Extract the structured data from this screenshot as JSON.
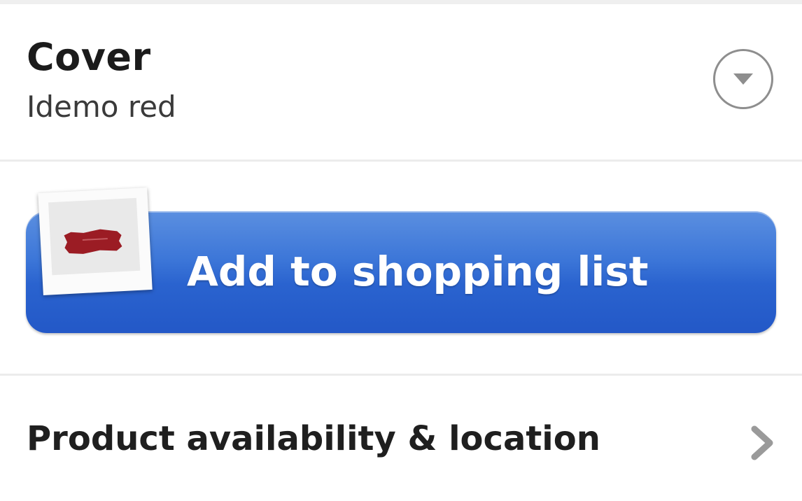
{
  "cover": {
    "title": "Cover",
    "value": "Idemo red",
    "dropdown_icon": "chevron-down-circle-icon"
  },
  "shopping_list": {
    "button_label": "Add to shopping list",
    "thumbnail_icon": "product-thumbnail-icon",
    "accent_color": "#2a63cf"
  },
  "product": {
    "label": "Product availability & location",
    "chevron_icon": "chevron-right-icon"
  }
}
